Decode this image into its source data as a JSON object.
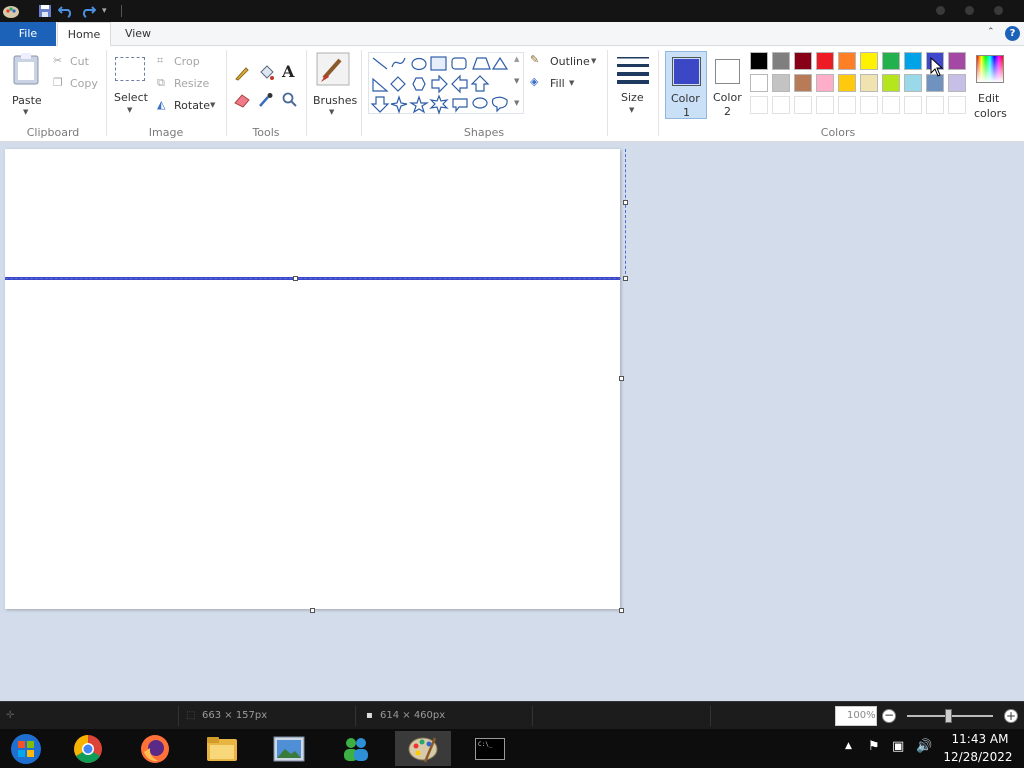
{
  "tabs": {
    "file": "File",
    "home": "Home",
    "view": "View"
  },
  "clipboard": {
    "paste": "Paste",
    "cut": "Cut",
    "copy": "Copy",
    "label": "Clipboard"
  },
  "image": {
    "select": "Select",
    "crop": "Crop",
    "resize": "Resize",
    "rotate": "Rotate",
    "label": "Image"
  },
  "tools": {
    "label": "Tools"
  },
  "brushes": {
    "label": "Brushes"
  },
  "shapes": {
    "outline": "Outline",
    "fill": "Fill",
    "label": "Shapes"
  },
  "size": {
    "label": "Size"
  },
  "colors": {
    "color1_line1": "Color",
    "color1_line2": "1",
    "color2_line1": "Color",
    "color2_line2": "2",
    "edit_line1": "Edit",
    "edit_line2": "colors",
    "label": "Colors",
    "color1_value": "#3c47c6",
    "color2_value": "#ffffff",
    "row1": [
      "#000000",
      "#7f7f7f",
      "#880015",
      "#ed1c24",
      "#ff7f27",
      "#fff200",
      "#22b14c",
      "#00a2e8",
      "#3f48cc",
      "#a349a4"
    ],
    "row2": [
      "#ffffff",
      "#c3c3c3",
      "#b97a57",
      "#ffaec9",
      "#ffc90e",
      "#efe4b0",
      "#b5e61d",
      "#99d9ea",
      "#7092be",
      "#c8bfe7"
    ]
  },
  "status": {
    "selection_size": "663 × 157px",
    "canvas_size": "614 × 460px",
    "zoom": "100%"
  },
  "clock": {
    "time": "11:43 AM",
    "date": "12/28/2022"
  }
}
